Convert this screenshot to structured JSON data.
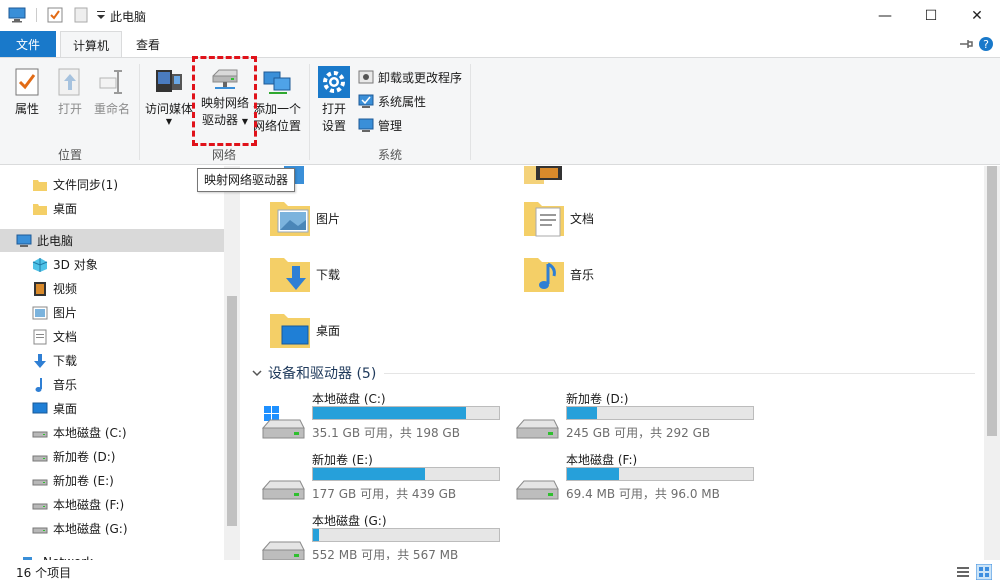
{
  "window": {
    "title": "此电脑",
    "minimize": "—",
    "maximize": "☐",
    "close": "✕"
  },
  "tabs": {
    "file": "文件",
    "computer": "计算机",
    "view": "查看"
  },
  "ribbon": {
    "location_group": "位置",
    "network_group": "网络",
    "system_group": "系统",
    "properties": "属性",
    "open": "打开",
    "rename": "重命名",
    "access_media": "访问媒体",
    "map_drive_line1": "映射网络",
    "map_drive_line2": "驱动器",
    "add_location_line1": "添加一个",
    "add_location_line2": "网络位置",
    "open_settings_line1": "打开",
    "open_settings_line2": "设置",
    "uninstall": "卸载或更改程序",
    "system_properties": "系统属性",
    "manage": "管理",
    "tooltip": "映射网络驱动器"
  },
  "nav": {
    "items": [
      {
        "label": "文件同步(1)",
        "icon": "folder-icon"
      },
      {
        "label": "桌面",
        "icon": "folder-icon"
      },
      {
        "label": "此电脑",
        "icon": "computer-icon"
      },
      {
        "label": "3D 对象",
        "icon": "3d-objects-icon"
      },
      {
        "label": "视频",
        "icon": "video-icon"
      },
      {
        "label": "图片",
        "icon": "pictures-icon"
      },
      {
        "label": "文档",
        "icon": "documents-icon"
      },
      {
        "label": "下载",
        "icon": "download-icon"
      },
      {
        "label": "音乐",
        "icon": "music-icon"
      },
      {
        "label": "桌面",
        "icon": "desktop-icon"
      },
      {
        "label": "本地磁盘 (C:)",
        "icon": "drive-icon"
      },
      {
        "label": "新加卷 (D:)",
        "icon": "drive-icon"
      },
      {
        "label": "新加卷 (E:)",
        "icon": "drive-icon"
      },
      {
        "label": "本地磁盘 (F:)",
        "icon": "drive-icon"
      },
      {
        "label": "本地磁盘 (G:)",
        "icon": "drive-icon"
      },
      {
        "label": "Network",
        "icon": "network-icon"
      }
    ]
  },
  "folders": [
    {
      "label": "图片"
    },
    {
      "label": "文档"
    },
    {
      "label": "下载"
    },
    {
      "label": "音乐"
    },
    {
      "label": "桌面"
    }
  ],
  "devices": {
    "heading": "设备和驱动器 (5)",
    "drives": [
      {
        "name": "本地磁盘 (C:)",
        "info": "35.1 GB 可用，共 198 GB",
        "used": 0.82
      },
      {
        "name": "新加卷 (D:)",
        "info": "245 GB 可用，共 292 GB",
        "used": 0.16
      },
      {
        "name": "新加卷 (E:)",
        "info": "177 GB 可用，共 439 GB",
        "used": 0.6
      },
      {
        "name": "本地磁盘 (F:)",
        "info": "69.4 MB 可用，共 96.0 MB",
        "used": 0.28
      },
      {
        "name": "本地磁盘 (G:)",
        "info": "552 MB 可用，共 567 MB",
        "used": 0.03
      }
    ]
  },
  "status": {
    "count": "16 个项目"
  },
  "colors": {
    "accent": "#1979ca",
    "bar": "#26a0da",
    "highlight": "#e0121a"
  }
}
